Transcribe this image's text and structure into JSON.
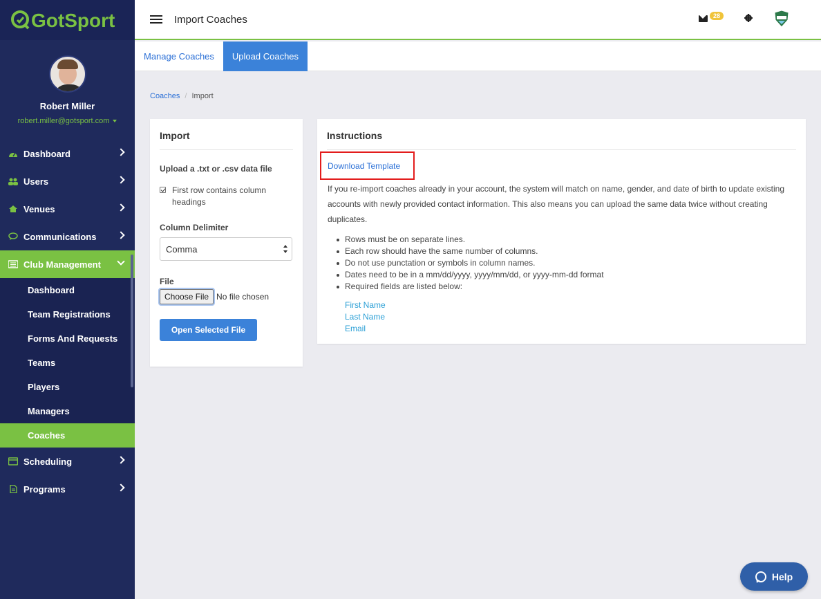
{
  "brand": {
    "name": "GotSport",
    "accent": "#7ac143",
    "sidebar_bg": "#1f2a5c",
    "primary": "#3b82d9"
  },
  "profile": {
    "name": "Robert Miller",
    "email": "robert.miller@gotsport.com"
  },
  "nav": {
    "items": [
      {
        "label": "Dashboard",
        "icon": "dashboard-icon"
      },
      {
        "label": "Users",
        "icon": "users-icon"
      },
      {
        "label": "Venues",
        "icon": "home-icon"
      },
      {
        "label": "Communications",
        "icon": "chat-icon"
      },
      {
        "label": "Club Management",
        "icon": "list-icon"
      },
      {
        "label": "Scheduling",
        "icon": "calendar-icon"
      },
      {
        "label": "Programs",
        "icon": "document-icon"
      }
    ],
    "sub_items": [
      "Dashboard",
      "Team Registrations",
      "Forms And Requests",
      "Teams",
      "Players",
      "Managers",
      "Coaches"
    ],
    "active_sub": "Coaches"
  },
  "header": {
    "title": "Import Coaches",
    "mail_count": "28"
  },
  "tabs": [
    {
      "label": "Manage Coaches"
    },
    {
      "label": "Upload Coaches"
    }
  ],
  "breadcrumb": {
    "parent": "Coaches",
    "separator": "/",
    "current": "Import"
  },
  "import": {
    "title": "Import",
    "upload_label": "Upload a .txt or .csv data file",
    "checkbox_label": "First row contains column headings",
    "checkbox_checked": true,
    "delimiter_label": "Column Delimiter",
    "delimiter_value": "Comma",
    "file_label": "File",
    "choose_file": "Choose File",
    "no_file": "No file chosen",
    "open_button": "Open Selected File"
  },
  "instructions": {
    "title": "Instructions",
    "download_template": "Download Template",
    "description": "If you re-import coaches already in your account, the system will match on name, gender, and date of birth to update existing accounts with newly provided contact information. This also means you can upload the same data twice without creating duplicates.",
    "rules": [
      "Rows must be on separate lines.",
      "Each row should have the same number of columns.",
      "Do not use punctation or symbols in column names.",
      "Dates need to be in a mm/dd/yyyy, yyyy/mm/dd, or yyyy-mm-dd format",
      "Required fields are listed below:"
    ],
    "required_fields": [
      "First Name",
      "Last Name",
      "Email"
    ]
  },
  "help": {
    "label": "Help"
  }
}
